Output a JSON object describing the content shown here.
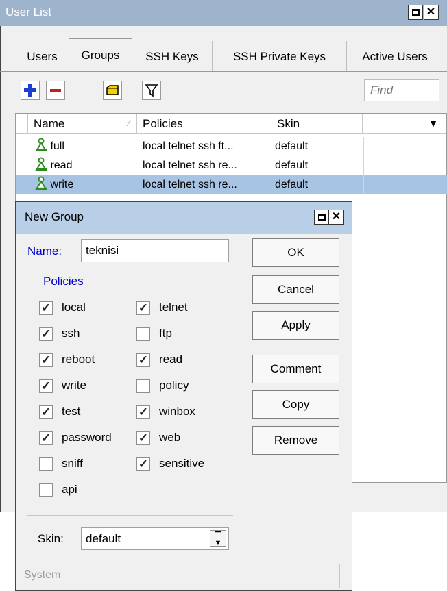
{
  "window": {
    "title": "User List",
    "tabs": [
      {
        "label": "Users",
        "active": false
      },
      {
        "label": "Groups",
        "active": true
      },
      {
        "label": "SSH Keys",
        "active": false
      },
      {
        "label": "SSH Private Keys",
        "active": false
      },
      {
        "label": "Active Users",
        "active": false
      }
    ],
    "toolbar": {
      "icons": [
        "add-icon",
        "remove-icon",
        "comment-icon",
        "filter-icon"
      ],
      "find_placeholder": "Find"
    },
    "table": {
      "columns": [
        "Name",
        "Policies",
        "Skin"
      ],
      "rows": [
        {
          "name": "full",
          "policies": "local telnet ssh ft...",
          "skin": "default",
          "selected": false
        },
        {
          "name": "read",
          "policies": "local telnet ssh re...",
          "skin": "default",
          "selected": false
        },
        {
          "name": "write",
          "policies": "local telnet ssh re...",
          "skin": "default",
          "selected": true
        }
      ]
    }
  },
  "dialog": {
    "title": "New Group",
    "name_label": "Name:",
    "name_value": "teknisi",
    "policies_label": "Policies",
    "policies": [
      {
        "label": "local",
        "checked": true
      },
      {
        "label": "telnet",
        "checked": true
      },
      {
        "label": "ssh",
        "checked": true
      },
      {
        "label": "ftp",
        "checked": false
      },
      {
        "label": "reboot",
        "checked": true
      },
      {
        "label": "read",
        "checked": true
      },
      {
        "label": "write",
        "checked": true
      },
      {
        "label": "policy",
        "checked": false
      },
      {
        "label": "test",
        "checked": true
      },
      {
        "label": "winbox",
        "checked": true
      },
      {
        "label": "password",
        "checked": true
      },
      {
        "label": "web",
        "checked": true
      },
      {
        "label": "sniff",
        "checked": false
      },
      {
        "label": "sensitive",
        "checked": true
      },
      {
        "label": "api",
        "checked": false
      }
    ],
    "buttons": {
      "ok": "OK",
      "cancel": "Cancel",
      "apply": "Apply",
      "comment": "Comment",
      "copy": "Copy",
      "remove": "Remove"
    },
    "skin_label": "Skin:",
    "skin_value": "default",
    "status": "System"
  },
  "colors": {
    "titlebar": "#9db4cc",
    "dialog_titlebar": "#b8cfe7",
    "selected_row": "#a8c4e4",
    "label_blue": "#0000cc",
    "add_icon": "#1c3fd0",
    "remove_icon": "#c81e1e",
    "comment_icon": "#f5d100",
    "group_icon": "#2e8b1e"
  }
}
